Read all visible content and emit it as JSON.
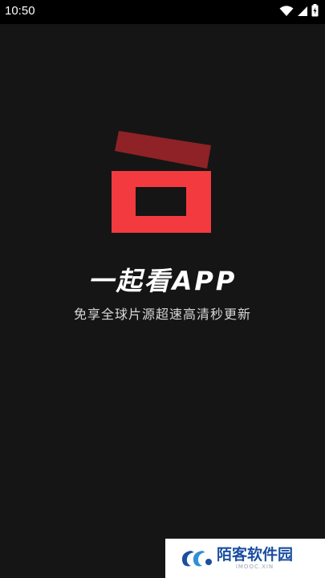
{
  "status_bar": {
    "time": "10:50",
    "icons": [
      "wifi-icon",
      "signal-icon",
      "battery-icon"
    ]
  },
  "splash": {
    "app_name": "一起看APP",
    "tagline": "免享全球片源超速高清秒更新",
    "logo_colors": {
      "body": "#f23a3f",
      "lid": "#8e2226",
      "background": "#151515"
    }
  },
  "watermark": {
    "title": "陌客软件园",
    "subtitle": "IMOOC.XIN"
  }
}
